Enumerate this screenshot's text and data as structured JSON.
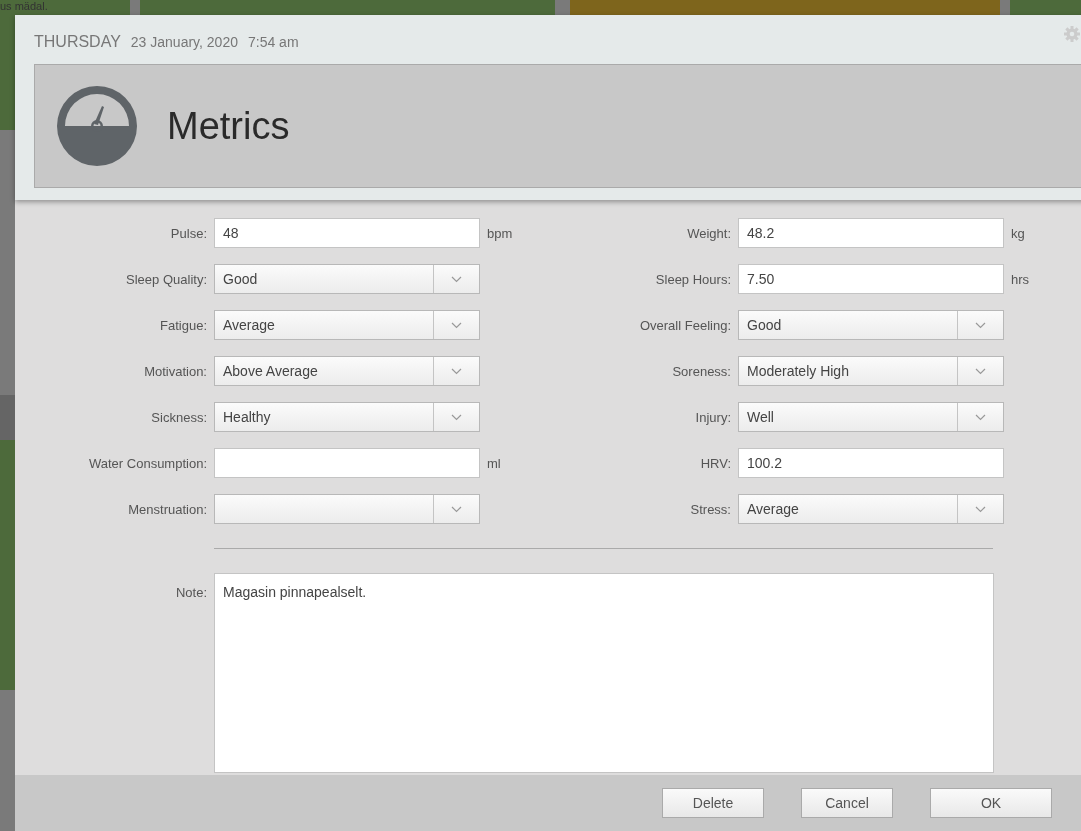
{
  "background": {
    "fragments": [
      "us mädal."
    ]
  },
  "dialog": {
    "day": "THURSDAY",
    "date": "23 January, 2020",
    "time": "7:54 am",
    "title": "Metrics",
    "rows": [
      {
        "left": {
          "label": "Pulse:",
          "kind": "text",
          "value": "48",
          "unit": "bpm"
        },
        "right": {
          "label": "Weight:",
          "kind": "text",
          "value": "48.2",
          "unit": "kg"
        }
      },
      {
        "left": {
          "label": "Sleep Quality:",
          "kind": "select",
          "value": "Good"
        },
        "right": {
          "label": "Sleep Hours:",
          "kind": "text",
          "value": "7.50",
          "unit": "hrs"
        }
      },
      {
        "left": {
          "label": "Fatigue:",
          "kind": "select",
          "value": "Average"
        },
        "right": {
          "label": "Overall Feeling:",
          "kind": "select",
          "value": "Good"
        }
      },
      {
        "left": {
          "label": "Motivation:",
          "kind": "select",
          "value": "Above Average"
        },
        "right": {
          "label": "Soreness:",
          "kind": "select",
          "value": "Moderately High"
        }
      },
      {
        "left": {
          "label": "Sickness:",
          "kind": "select",
          "value": "Healthy"
        },
        "right": {
          "label": "Injury:",
          "kind": "select",
          "value": "Well"
        }
      },
      {
        "left": {
          "label": "Water Consumption:",
          "kind": "text",
          "unit": "ml"
        },
        "right": {
          "label": "HRV:",
          "kind": "text",
          "value": "100.2"
        }
      },
      {
        "left": {
          "label": "Menstruation:",
          "kind": "select"
        },
        "right": {
          "label": "Stress:",
          "kind": "select",
          "value": "Average"
        }
      }
    ],
    "note": {
      "label": "Note:",
      "value": "Magasin pinnapealselt."
    },
    "buttons": [
      "Delete",
      "Cancel",
      "OK"
    ]
  }
}
